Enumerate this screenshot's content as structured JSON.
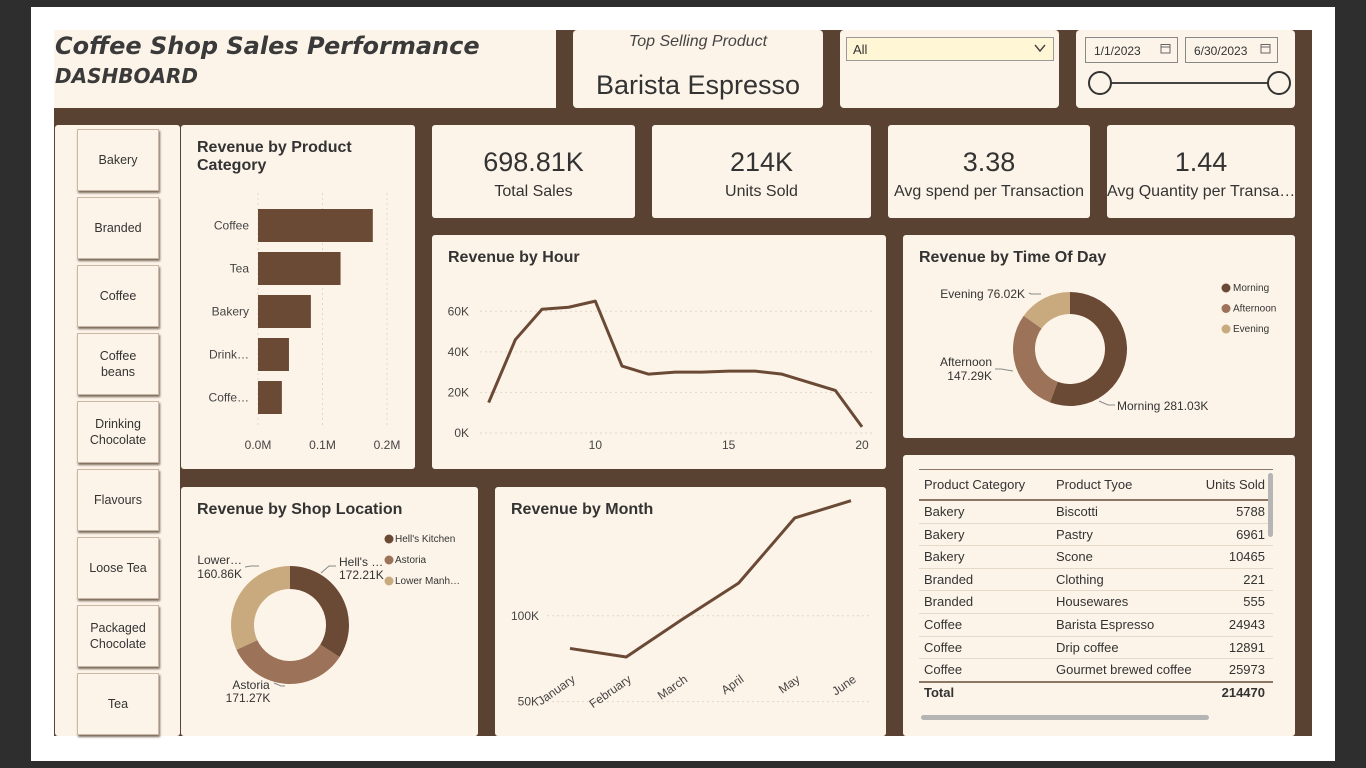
{
  "header": {
    "title_line1": "Coffee Shop Sales Performance",
    "title_line2": "DASHBOARD",
    "top_selling_label": "Top Selling Product",
    "top_selling_value": "Barista Espresso",
    "filter_value": "All",
    "date_start": "1/1/2023",
    "date_end": "6/30/2023"
  },
  "sidebar": {
    "items": [
      {
        "label": "Bakery"
      },
      {
        "label": "Branded"
      },
      {
        "label": "Coffee"
      },
      {
        "label": "Coffee beans"
      },
      {
        "label": "Drinking Chocolate"
      },
      {
        "label": "Flavours"
      },
      {
        "label": "Loose Tea"
      },
      {
        "label": "Packaged Chocolate"
      },
      {
        "label": "Tea"
      }
    ]
  },
  "kpis": [
    {
      "value": "698.81K",
      "label": "Total Sales"
    },
    {
      "value": "214K",
      "label": "Units Sold"
    },
    {
      "value": "3.38",
      "label": "Avg spend per Transaction"
    },
    {
      "value": "1.44",
      "label": "Avg Quantity per Transa…"
    }
  ],
  "colors": {
    "accent": "#6b4a35",
    "mid": "#9c7358",
    "light": "#c8aa7e",
    "panel": "#fdf4e9",
    "board": "#5a4233"
  },
  "chart_data": [
    {
      "type": "bar",
      "title_line1": "Revenue by Product",
      "title_line2": "Category",
      "categories": [
        "Coffee",
        "Tea",
        "Bakery",
        "Drink…",
        "Coffe…"
      ],
      "values": [
        0.178,
        0.128,
        0.082,
        0.048,
        0.037
      ],
      "x_ticks": [
        "0.0M",
        "0.1M",
        "0.2M"
      ],
      "xlim": [
        0,
        0.2
      ]
    },
    {
      "type": "line",
      "title": "Revenue by Hour",
      "x": [
        6,
        7,
        8,
        9,
        10,
        11,
        12,
        13,
        14,
        15,
        16,
        17,
        18,
        19,
        20
      ],
      "y": [
        15000,
        46000,
        61000,
        62000,
        65000,
        33000,
        29000,
        30000,
        30000,
        30500,
        30500,
        29000,
        25000,
        21000,
        3000
      ],
      "x_ticks": [
        "10",
        "15",
        "20"
      ],
      "y_ticks": [
        "0K",
        "20K",
        "40K",
        "60K"
      ],
      "xlim": [
        5,
        20
      ],
      "ylim": [
        0,
        70000
      ]
    },
    {
      "type": "pie",
      "title": "Revenue by Time Of Day",
      "labels": [
        "Morning",
        "Afternoon",
        "Evening"
      ],
      "values": [
        281.03,
        147.29,
        76.02
      ],
      "data_labels": [
        "Morning 281.03K",
        "Afternoon",
        "147.29K",
        "Evening 76.02K"
      ],
      "legend": [
        "Morning",
        "Afternoon",
        "Evening"
      ]
    },
    {
      "type": "pie",
      "title": "Revenue by Shop Location",
      "labels": [
        "Hell's Kitchen",
        "Astoria",
        "Lower Manhattan"
      ],
      "values": [
        172.21,
        171.27,
        160.86
      ],
      "data_labels": [
        "Hell's …",
        "172.21K",
        "Astoria",
        "171.27K",
        "Lower…",
        "160.86K"
      ],
      "legend": [
        "Hell's Kitchen",
        "Astoria",
        "Lower Manh…"
      ]
    },
    {
      "type": "line",
      "title": "Revenue by Month",
      "categories": [
        "January",
        "February",
        "March",
        "April",
        "May",
        "June"
      ],
      "values": [
        81000,
        76000,
        98000,
        119000,
        157000,
        167000
      ],
      "y_ticks": [
        "50K",
        "100K"
      ],
      "ylim": [
        30000,
        175000
      ]
    },
    {
      "type": "table",
      "columns": [
        "Product Category",
        "Product Tyoe",
        "Units Sold"
      ],
      "rows": [
        [
          "Bakery",
          "Biscotti",
          "5788"
        ],
        [
          "Bakery",
          "Pastry",
          "6961"
        ],
        [
          "Bakery",
          "Scone",
          "10465"
        ],
        [
          "Branded",
          "Clothing",
          "221"
        ],
        [
          "Branded",
          "Housewares",
          "555"
        ],
        [
          "Coffee",
          "Barista Espresso",
          "24943"
        ],
        [
          "Coffee",
          "Drip coffee",
          "12891"
        ],
        [
          "Coffee",
          "Gourmet brewed coffee",
          "25973"
        ]
      ],
      "total_label": "Total",
      "total_value": "214470"
    }
  ]
}
